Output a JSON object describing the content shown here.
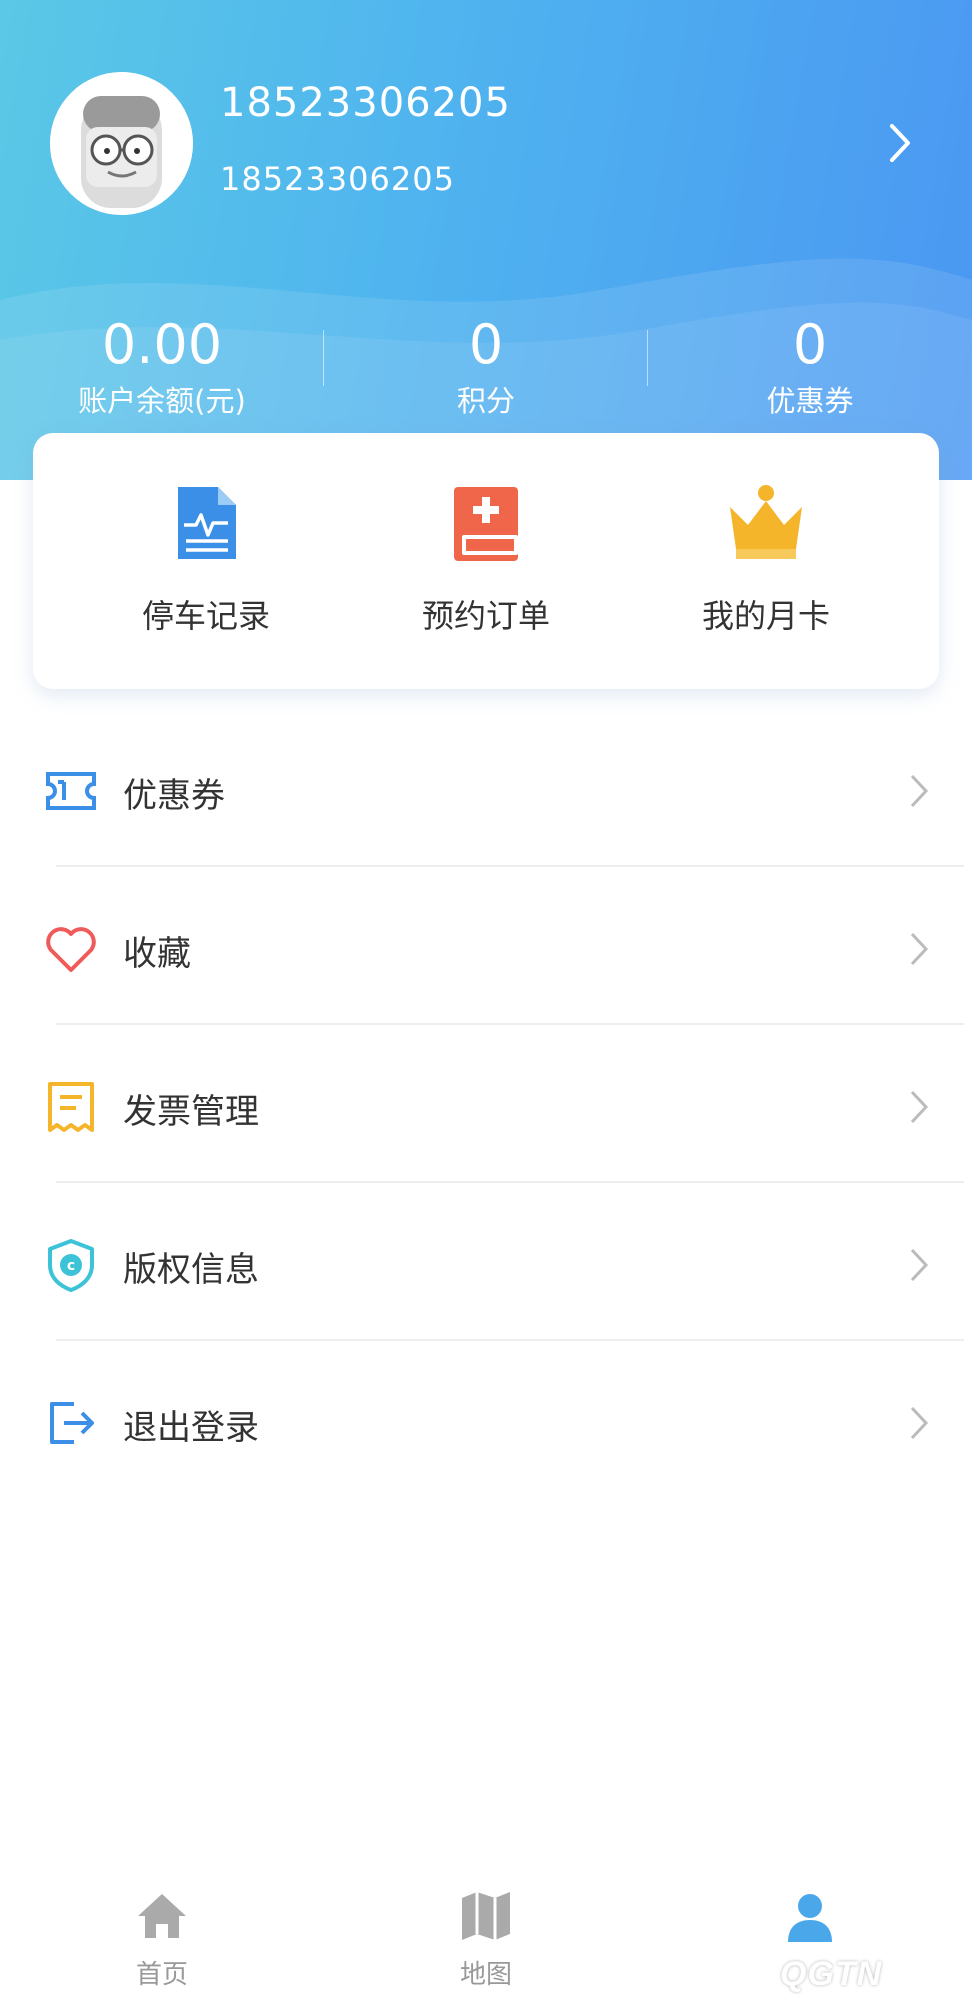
{
  "profile": {
    "username": "18523306205",
    "phone": "18523306205"
  },
  "stats": [
    {
      "value": "0.00",
      "label": "账户余额(元)"
    },
    {
      "value": "0",
      "label": "积分"
    },
    {
      "value": "0",
      "label": "优惠券"
    }
  ],
  "quick_actions": [
    {
      "label": "停车记录",
      "icon": "parking-record-icon",
      "color": "#3b8fe6"
    },
    {
      "label": "预约订单",
      "icon": "reservation-order-icon",
      "color": "#f0664a"
    },
    {
      "label": "我的月卡",
      "icon": "crown-icon",
      "color": "#f5b52a"
    }
  ],
  "menu": [
    {
      "label": "优惠券",
      "icon": "ticket-icon",
      "color": "#3b8fe6"
    },
    {
      "label": "收藏",
      "icon": "heart-icon",
      "color": "#ef5a5a"
    },
    {
      "label": "发票管理",
      "icon": "invoice-icon",
      "color": "#f5b52a"
    },
    {
      "label": "版权信息",
      "icon": "copyright-shield-icon",
      "color": "#3cc3d8"
    },
    {
      "label": "退出登录",
      "icon": "logout-icon",
      "color": "#3b8fe6"
    }
  ],
  "tabs": [
    {
      "label": "首页",
      "icon": "home-icon",
      "active": false
    },
    {
      "label": "地图",
      "icon": "map-icon",
      "active": false
    },
    {
      "label": "",
      "icon": "user-icon",
      "active": true
    }
  ],
  "watermark": "QGTN",
  "colors": {
    "header_start": "#5ac8e6",
    "header_end": "#4a97f2",
    "tab_inactive": "#999999",
    "tab_active": "#4aa8ea"
  }
}
